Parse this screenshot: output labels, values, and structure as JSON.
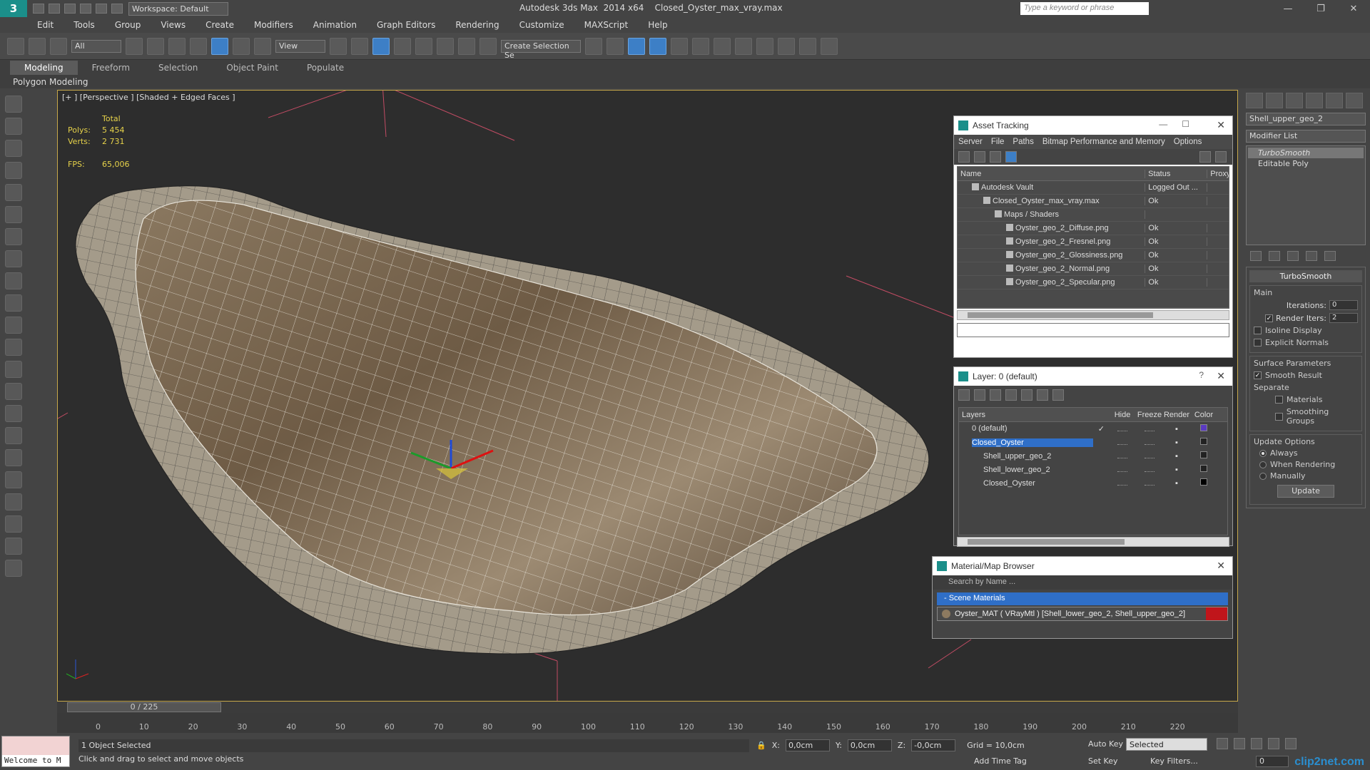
{
  "app": {
    "title": "Autodesk 3ds Max  2014 x64    Closed_Oyster_max_vray.max",
    "workspace": "Workspace: Default",
    "search_placeholder": "Type a keyword or phrase"
  },
  "menu": [
    "Edit",
    "Tools",
    "Group",
    "Views",
    "Create",
    "Modifiers",
    "Animation",
    "Graph Editors",
    "Rendering",
    "Customize",
    "MAXScript",
    "Help"
  ],
  "toolbar": {
    "filter": "All",
    "ref_coord": "View",
    "selection_set": "Create Selection Se"
  },
  "ribbon": {
    "tabs": [
      "Modeling",
      "Freeform",
      "Selection",
      "Object Paint",
      "Populate"
    ],
    "active": "Modeling",
    "sub": "Polygon Modeling"
  },
  "viewport": {
    "label": "[+ ] [Perspective ] [Shaded + Edged Faces ]",
    "stats": {
      "header": "Total",
      "polys_label": "Polys:",
      "polys": "5 454",
      "verts_label": "Verts:",
      "verts": "2 731",
      "fps_label": "FPS:",
      "fps": "65,006"
    }
  },
  "command_panel": {
    "object_name": "Shell_upper_geo_2",
    "modifier_list": "Modifier List",
    "stack": [
      "TurboSmooth",
      "Editable Poly"
    ],
    "turbosmooth": {
      "title": "TurboSmooth",
      "main": "Main",
      "iterations_label": "Iterations:",
      "iterations": "0",
      "render_iters_label": "Render Iters:",
      "render_iters": "2",
      "isoline": "Isoline Display",
      "explicit": "Explicit Normals",
      "surface": "Surface Parameters",
      "smooth_result": "Smooth Result",
      "separate": "Separate",
      "materials": "Materials",
      "smoothing_groups": "Smoothing Groups",
      "update_options": "Update Options",
      "always": "Always",
      "when_rendering": "When Rendering",
      "manually": "Manually",
      "update": "Update"
    }
  },
  "asset_tracking": {
    "title": "Asset Tracking",
    "menu": [
      "Server",
      "File",
      "Paths",
      "Bitmap Performance and Memory",
      "Options"
    ],
    "columns": [
      "Name",
      "Status",
      "Proxy"
    ],
    "rows": [
      {
        "name": "Autodesk Vault",
        "status": "Logged Out ..."
      },
      {
        "name": "Closed_Oyster_max_vray.max",
        "status": "Ok"
      },
      {
        "name": "Maps / Shaders",
        "status": ""
      },
      {
        "name": "Oyster_geo_2_Diffuse.png",
        "status": "Ok"
      },
      {
        "name": "Oyster_geo_2_Fresnel.png",
        "status": "Ok"
      },
      {
        "name": "Oyster_geo_2_Glossiness.png",
        "status": "Ok"
      },
      {
        "name": "Oyster_geo_2_Normal.png",
        "status": "Ok"
      },
      {
        "name": "Oyster_geo_2_Specular.png",
        "status": "Ok"
      }
    ]
  },
  "layers": {
    "title": "Layer: 0 (default)",
    "help": "?",
    "columns": [
      "Layers",
      "Hide",
      "Freeze",
      "Render",
      "Color"
    ],
    "rows": [
      {
        "name": "0 (default)"
      },
      {
        "name": "Closed_Oyster"
      },
      {
        "name": "Shell_upper_geo_2"
      },
      {
        "name": "Shell_lower_geo_2"
      },
      {
        "name": "Closed_Oyster"
      }
    ]
  },
  "material_browser": {
    "title": "Material/Map Browser",
    "search": "Search by Name ...",
    "section": "- Scene Materials",
    "item": "Oyster_MAT  ( VRayMtl )  [Shell_lower_geo_2, Shell_upper_geo_2]"
  },
  "timeline": {
    "frame": "0 / 225",
    "ticks": [
      "0",
      "10",
      "20",
      "30",
      "40",
      "50",
      "60",
      "70",
      "80",
      "90",
      "100",
      "110",
      "120",
      "130",
      "140",
      "150",
      "160",
      "170",
      "180",
      "190",
      "200",
      "210",
      "220"
    ]
  },
  "status": {
    "maxscript": "Welcome to M",
    "selected": "1 Object Selected",
    "prompt": "Click and drag to select and move objects",
    "x_label": "X:",
    "x": "0,0cm",
    "y_label": "Y:",
    "y": "0,0cm",
    "z_label": "Z:",
    "z": "-0,0cm",
    "grid": "Grid = 10,0cm",
    "add_time_tag": "Add Time Tag",
    "auto_key": "Auto Key",
    "set_key": "Set Key",
    "selected_dd": "Selected",
    "key_filters": "Key Filters...",
    "frame_field": "0"
  },
  "watermark": "clip2net.com"
}
